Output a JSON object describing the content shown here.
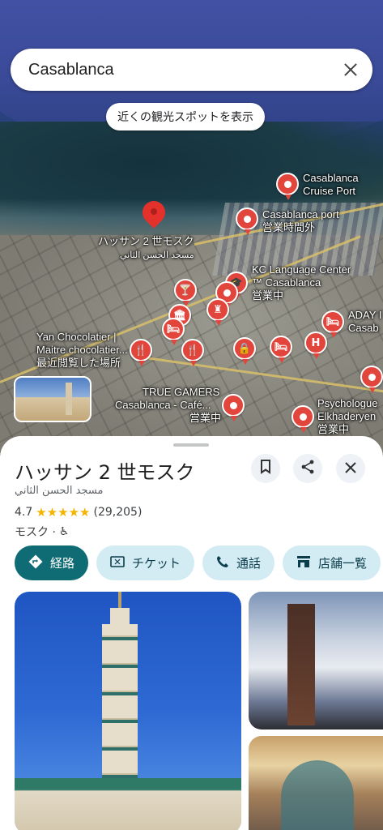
{
  "search": {
    "query": "Casablanca"
  },
  "map": {
    "nearby_chip": "近くの観光スポットを表示",
    "labels": {
      "cruise_port_1": "Casablanca",
      "cruise_port_2": "Cruise Port",
      "port": "Casablanca port",
      "port_status": "営業時間外",
      "mosque_jp": "ハッサン 2 世モスク",
      "mosque_ar": "مسجد الحسن الثاني",
      "kc_1": "KC Language Center",
      "kc_2": "™ Casablanca",
      "kc_status": "営業中",
      "yan_1": "Yan Chocolatier |",
      "yan_2": "Maitre chocolatier...",
      "yan_status": "最近閲覧した場所",
      "aday_1": "ADAY I",
      "aday_2": "Casab",
      "true_1": "TRUE GAMERS",
      "true_2": "Casablanca -  Café...",
      "true_status": "営業中",
      "psy_1": "Psychologue",
      "psy_2": "Elkhaderyen",
      "psy_status": "営業中"
    },
    "pin_colors": {
      "pin": "#e2453c"
    }
  },
  "place": {
    "title": "ハッサン 2 世モスク",
    "subtitle_ar": "مسجد الحسن الثاني",
    "rating": "4.7",
    "stars": "★★★★★",
    "review_count": "(29,205)",
    "category": "モスク ·",
    "wheelchair_icon": "♿"
  },
  "actions": {
    "directions": "経路",
    "tickets": "チケット",
    "call": "通話",
    "store_list": "店舗一覧"
  },
  "colors": {
    "primary_action": "#0f6b74",
    "secondary_action": "#d3ecf4",
    "star": "#f4b400"
  }
}
